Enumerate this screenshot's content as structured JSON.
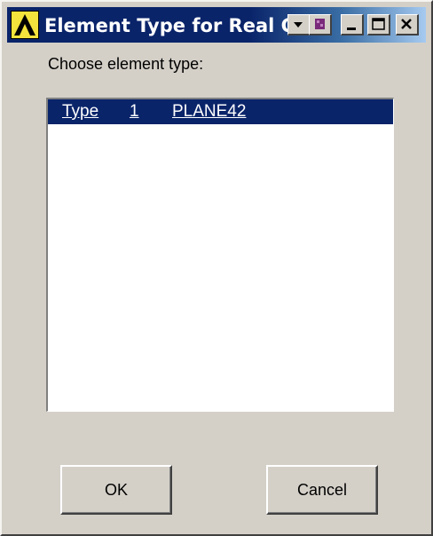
{
  "window": {
    "title": "Element Type for Real Co",
    "buttons": {
      "menu": "menu-button",
      "palette": "palette-button",
      "minimize": "minimize-button",
      "maximize": "maximize-button",
      "close": "close-button"
    }
  },
  "dialog": {
    "prompt": "Choose element type:",
    "list": {
      "items": [
        {
          "type_label": "Type",
          "number": "1",
          "name": "PLANE42",
          "selected": true
        }
      ]
    },
    "ok_label": "OK",
    "cancel_label": "Cancel"
  },
  "colors": {
    "face": "#d4d0c8",
    "titlebar_start": "#0a246a",
    "titlebar_end": "#a6caf0",
    "selection": "#0a246a",
    "icon_bg": "#f3e33c"
  }
}
